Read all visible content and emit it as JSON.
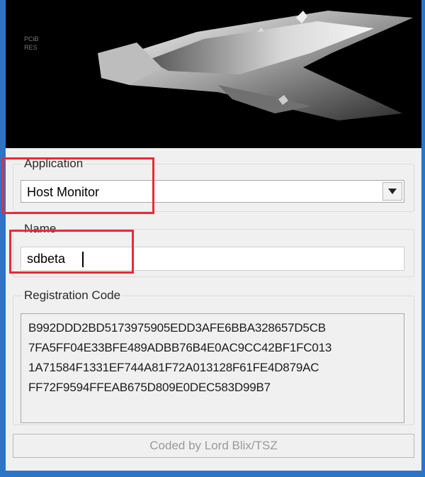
{
  "application": {
    "legend": "Application",
    "selected": "Host Monitor"
  },
  "name": {
    "legend": "Name",
    "value": "sdbeta"
  },
  "registration": {
    "legend": "Registration Code",
    "lines": [
      "B992DDD2BD5173975905EDD3AFE6BBA328657D5CB",
      "7FA5FF04E33BFE489ADBB76B4E0AC9CC42BF1FC013",
      "1A71584F1331EF744A81F72A013128F61FE4D879AC",
      "FF72F9594FFEAB675D809E0DEC583D99B7"
    ]
  },
  "status": {
    "text": "Coded by Lord Blix/TSZ"
  },
  "colors": {
    "highlight": "#ea2a3a",
    "frame": "#2b74c7"
  },
  "icons": {
    "dropdown": "chevron-down-icon",
    "banner": "tsz-logo-art"
  }
}
